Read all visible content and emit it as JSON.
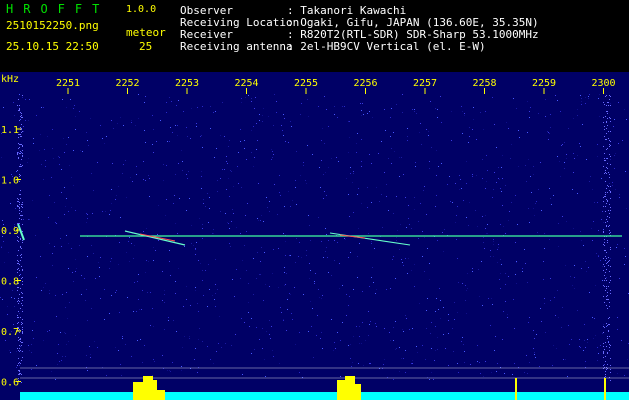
{
  "header": {
    "brand": "HROFFT",
    "version": "1.0.0",
    "filename": "2510152250.png",
    "meteor_label": "meteor",
    "timestamp": "25.10.15 22:50",
    "meteor_count": "25",
    "info": [
      {
        "key": "Observer",
        "value": ": Takanori Kawachi"
      },
      {
        "key": "Receiving Location",
        "value": ": Ogaki, Gifu, JAPAN (136.60E, 35.35N)"
      },
      {
        "key": "Receiver",
        "value": ": R820T2(RTL-SDR) SDR-Sharp 53.1000MHz"
      },
      {
        "key": "Receiving antenna",
        "value": ": 2el-HB9CV Vertical (el. E-W)"
      }
    ]
  },
  "chart_data": {
    "type": "heatmap",
    "ylabel": "kHz",
    "x_ticks": [
      "2251",
      "2252",
      "2253",
      "2254",
      "2255",
      "2256",
      "2257",
      "2258",
      "2259",
      "2300"
    ],
    "y_ticks": [
      "1.1",
      "1.0",
      "0.9",
      "0.8",
      "0.7",
      "0.6"
    ],
    "y_tick_values": [
      1.1,
      1.0,
      0.9,
      0.8,
      0.7,
      0.6
    ],
    "ylim": [
      0.58,
      1.2
    ],
    "carrier_khz": 0.9,
    "colors": {
      "background": "#000066",
      "tick_labels": "#ffff00",
      "grid": "#ffffff",
      "carrier": "#40ffa0",
      "activity": "#ffff00",
      "baseline": "#00ffff"
    }
  }
}
